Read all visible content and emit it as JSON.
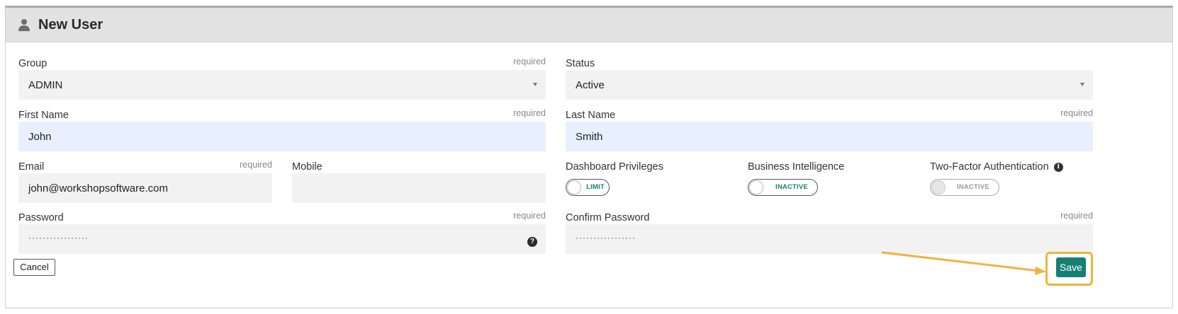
{
  "header": {
    "title": "New User",
    "icon": "user-icon"
  },
  "required_text": "required",
  "fields": {
    "group": {
      "label": "Group",
      "value": "ADMIN"
    },
    "status": {
      "label": "Status",
      "value": "Active"
    },
    "first_name": {
      "label": "First Name",
      "value": "John"
    },
    "last_name": {
      "label": "Last Name",
      "value": "Smith"
    },
    "email": {
      "label": "Email",
      "value": "john@workshopsoftware.com"
    },
    "mobile": {
      "label": "Mobile",
      "value": ""
    },
    "password": {
      "label": "Password",
      "value": "·················"
    },
    "confirm_password": {
      "label": "Confirm Password",
      "value": "·················"
    }
  },
  "toggles": {
    "dashboard_privileges": {
      "label": "Dashboard Privileges",
      "state": "LIMIT",
      "color": "#157f74"
    },
    "business_intelligence": {
      "label": "Business Intelligence",
      "state": "INACTIVE",
      "color": "#157f74"
    },
    "two_factor": {
      "label": "Two-Factor Authentication",
      "state": "INACTIVE",
      "color": "#999999"
    }
  },
  "buttons": {
    "cancel": "Cancel",
    "save": "Save"
  },
  "colors": {
    "accent": "#157f74",
    "highlight": "#f2b33d",
    "input_bg": "#f2f2f2",
    "autofill_bg": "#e8f0fe"
  }
}
